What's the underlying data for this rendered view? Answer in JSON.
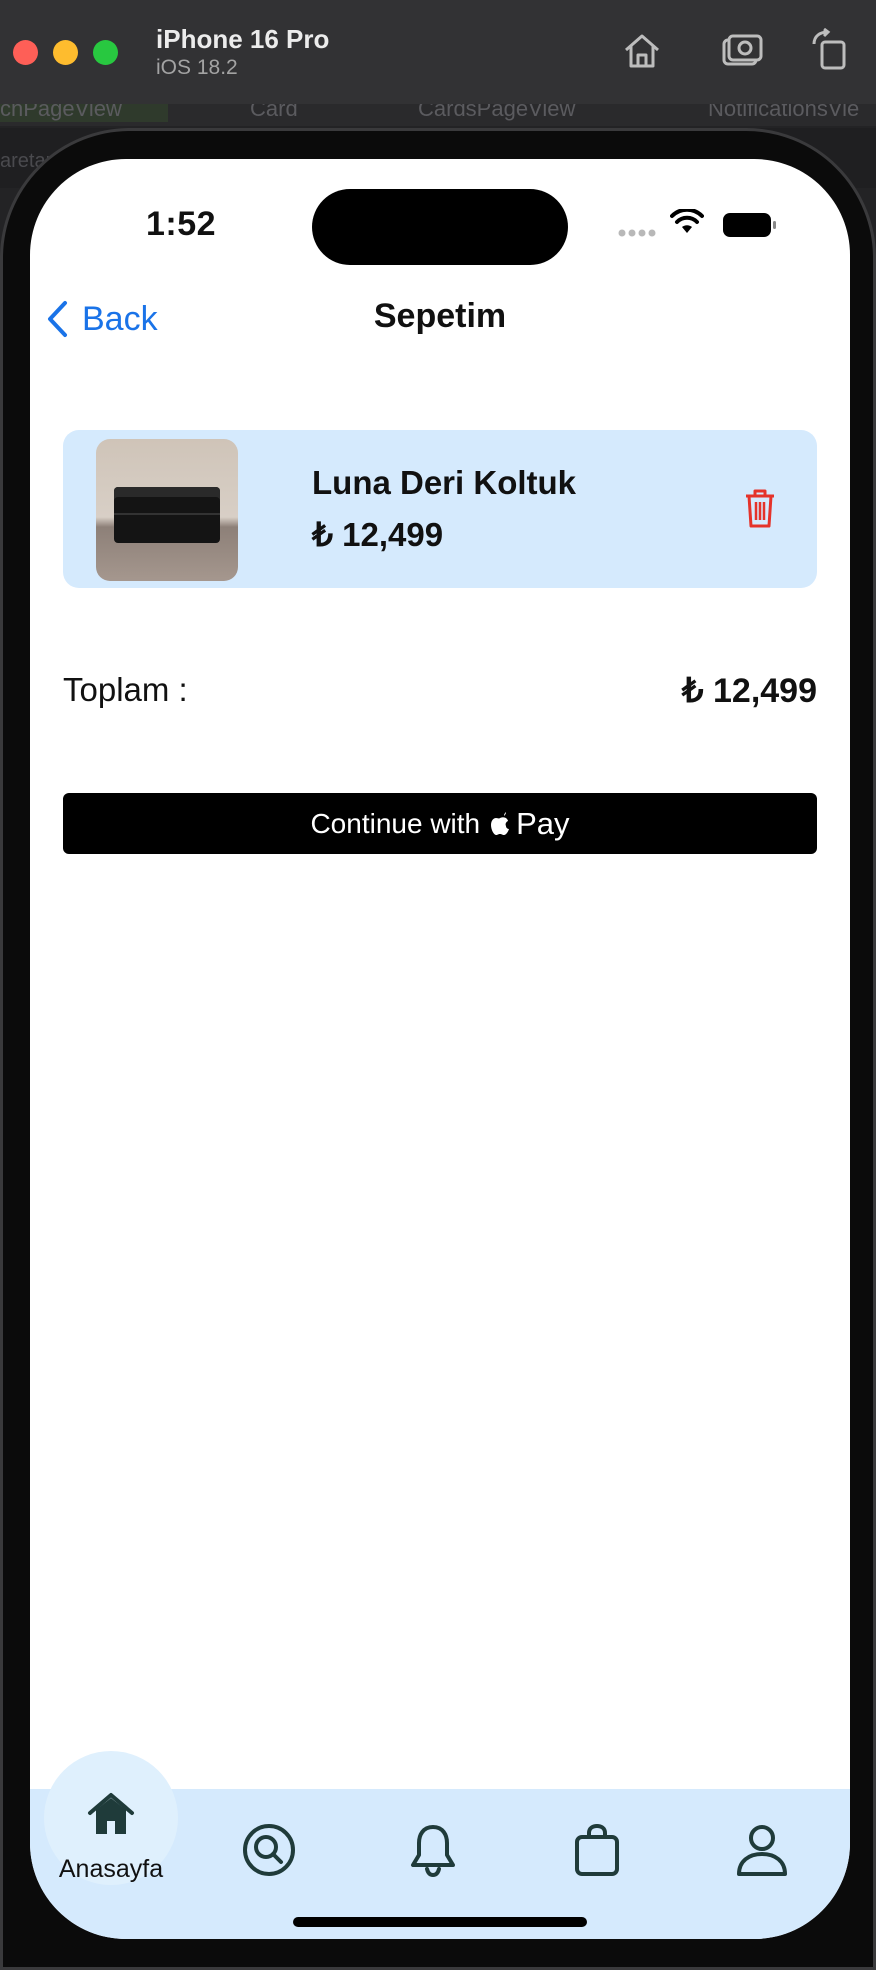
{
  "simulator": {
    "device": "iPhone 16 Pro",
    "os": "iOS 18.2"
  },
  "editor_tabs": [
    "chPageView",
    "Card",
    "CardsPageView",
    "NotificationsVie"
  ],
  "editor_row_text": "aretan",
  "status_bar": {
    "time": "1:52"
  },
  "nav": {
    "back_label": "Back",
    "title": "Sepetim"
  },
  "cart": {
    "items": [
      {
        "name": "Luna Deri Koltuk",
        "price": "₺ 12,499",
        "image_icon": "sofa-image"
      }
    ],
    "total_label": "Toplam :",
    "total_value": "₺ 12,499",
    "pay_button": {
      "prefix": "Continue with",
      "suffix": "Pay"
    }
  },
  "tab_bar": {
    "active": "Anasayfa",
    "items": [
      {
        "id": "home",
        "label": "Anasayfa",
        "icon": "home-icon"
      },
      {
        "id": "search",
        "icon": "search-icon"
      },
      {
        "id": "notifications",
        "icon": "bell-icon"
      },
      {
        "id": "cart",
        "icon": "bag-icon"
      },
      {
        "id": "profile",
        "icon": "user-icon"
      }
    ]
  },
  "colors": {
    "accent": "#1a73e8",
    "card_bg": "#d5eafd",
    "delete": "#e5332a",
    "tab_icon": "#1f3b3a"
  }
}
